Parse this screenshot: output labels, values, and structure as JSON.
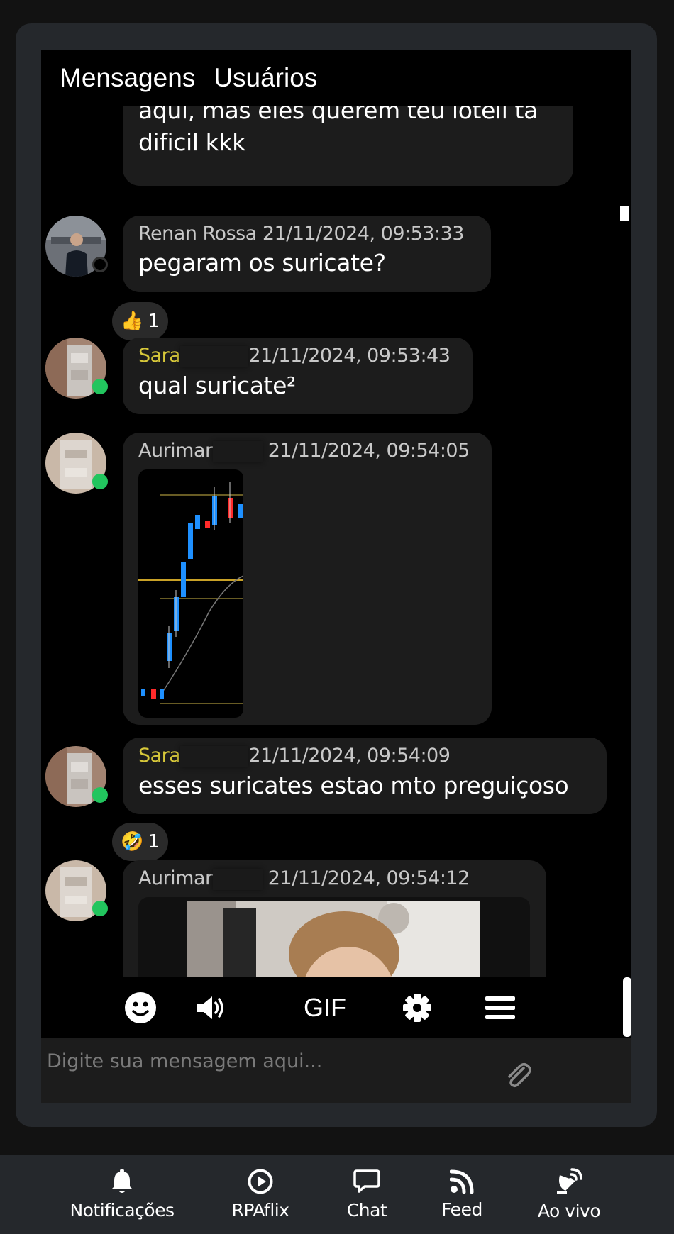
{
  "tabs": {
    "messages": "Mensagens",
    "users": "Usuários"
  },
  "messages": [
    {
      "text_line1": "aqui, mas eles querem teu loteil ta",
      "text_line2": "dificil kkk"
    },
    {
      "name": "Renan Rossa",
      "time": "21/11/2024, 09:53:33",
      "text": "pegaram os suricate?",
      "status": "offline",
      "reaction": {
        "emoji": "👍",
        "count": "1"
      }
    },
    {
      "name": "Sara",
      "time": "21/11/2024, 09:53:43",
      "text": "qual suricate²",
      "status": "online"
    },
    {
      "name": "Aurimar",
      "time": "21/11/2024, 09:54:05",
      "image": "candlestick-chart-screenshot",
      "status": "online"
    },
    {
      "name": "Sara",
      "time": "21/11/2024, 09:54:09",
      "text": "esses suricates estao mto preguiçoso",
      "status": "online",
      "reaction": {
        "emoji": "🤣",
        "count": "1"
      }
    },
    {
      "name": "Aurimar",
      "time": "21/11/2024, 09:54:12",
      "image": "gif-boy",
      "status": "online"
    }
  ],
  "toolbar": {
    "gif_label": "GIF",
    "icons": [
      "emoji-icon",
      "volume-icon",
      "gif",
      "gear-icon",
      "menu-icon"
    ]
  },
  "input": {
    "placeholder": "Digite sua mensagem aqui..."
  },
  "nav": [
    {
      "label": "Notificações",
      "icon": "bell-icon"
    },
    {
      "label": "RPAflix",
      "icon": "play-circle-icon"
    },
    {
      "label": "Chat",
      "icon": "chat-icon"
    },
    {
      "label": "Feed",
      "icon": "rss-icon"
    },
    {
      "label": "Ao vivo",
      "icon": "satellite-dish-icon"
    }
  ],
  "colors": {
    "background": "#121212",
    "panel": "#25282c",
    "bubble": "#1c1c1c",
    "name_highlight": "#d7c83a",
    "online": "#22c55e"
  }
}
